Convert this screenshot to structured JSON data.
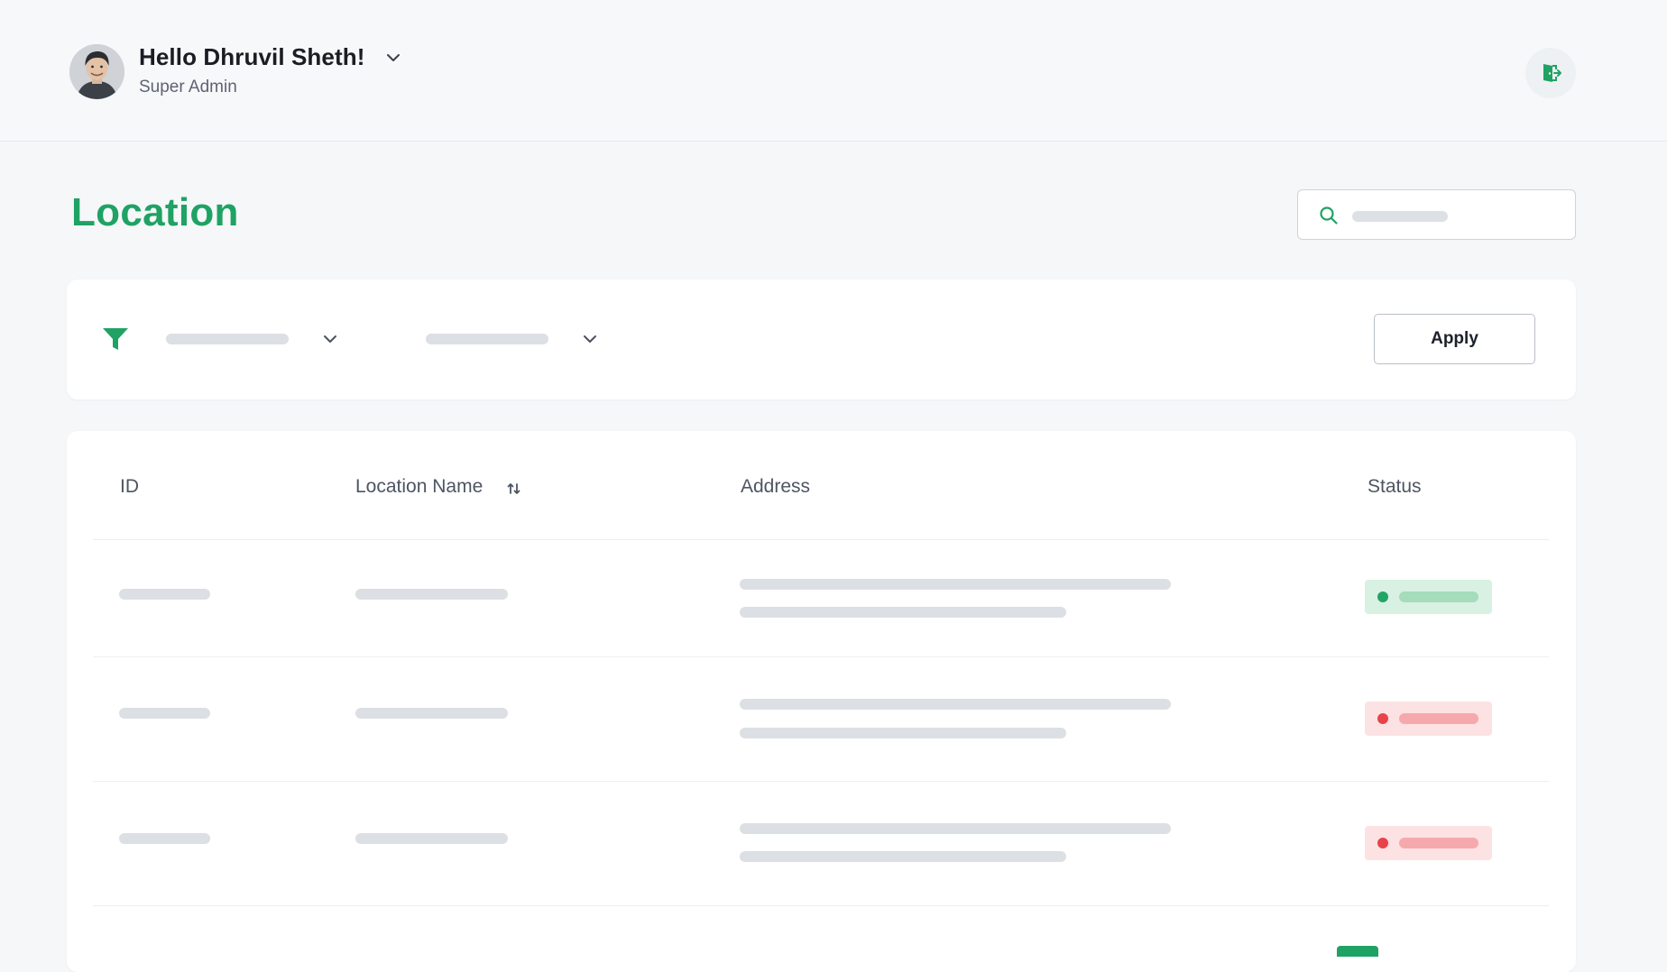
{
  "header": {
    "greeting": "Hello Dhruvil Sheth!",
    "role": "Super Admin"
  },
  "page": {
    "title": "Location"
  },
  "filters": {
    "apply_label": "Apply"
  },
  "table": {
    "columns": [
      "ID",
      "Location Name",
      "Address",
      "Status"
    ],
    "rows": [
      {
        "status": "active"
      },
      {
        "status": "inactive"
      },
      {
        "status": "inactive"
      }
    ]
  },
  "colors": {
    "brand": "#1fa264",
    "active": "#23a464",
    "inactive": "#e8434a"
  },
  "icons": {
    "logout": "logout-door-icon",
    "search": "search-icon",
    "filter": "filter-funnel-icon",
    "sort": "sort-arrows-icon",
    "dropdown": "chevron-down-icon"
  }
}
